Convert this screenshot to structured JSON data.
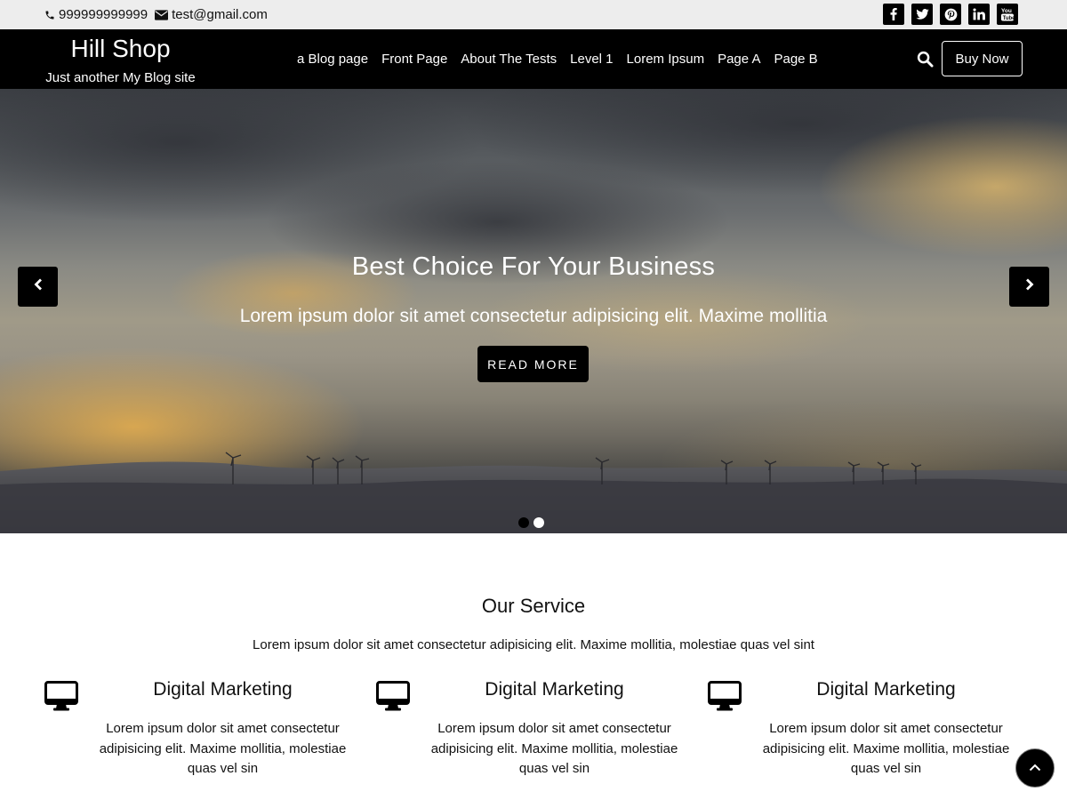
{
  "topbar": {
    "phone": "999999999999",
    "email": "test@gmail.com",
    "social": [
      "facebook-icon",
      "twitter-icon",
      "pinterest-icon",
      "linkedin-icon",
      "youtube-icon"
    ]
  },
  "header": {
    "site_title": "Hill Shop",
    "tagline": "Just another My Blog site",
    "nav": [
      "a Blog page",
      "Front Page",
      "About The Tests",
      "Level 1",
      "Lorem Ipsum",
      "Page A",
      "Page B"
    ],
    "buy_label": "Buy Now"
  },
  "hero": {
    "title": "Best Choice For Your Business",
    "subtitle": "Lorem ipsum dolor sit amet consectetur adipisicing elit. Maxime mollitia",
    "cta": "READ MORE",
    "active_slide": 1,
    "slide_count": 2
  },
  "services": {
    "heading": "Our Service",
    "intro": "Lorem ipsum dolor sit amet consectetur adipisicing elit. Maxime mollitia, molestiae quas vel sint",
    "items": [
      {
        "icon": "desktop-icon",
        "title": "Digital Marketing",
        "text": "Lorem ipsum dolor sit amet consectetur adipisicing elit. Maxime mollitia, molestiae quas vel sin"
      },
      {
        "icon": "desktop-icon",
        "title": "Digital Marketing",
        "text": "Lorem ipsum dolor sit amet consectetur adipisicing elit. Maxime mollitia, molestiae quas vel sin"
      },
      {
        "icon": "desktop-icon",
        "title": "Digital Marketing",
        "text": "Lorem ipsum dolor sit amet consectetur adipisicing elit. Maxime mollitia, molestiae quas vel sin"
      }
    ]
  },
  "colors": {
    "header_bg": "#000000",
    "topbar_bg": "#ededed",
    "accent": "#000000",
    "text": "#111111"
  }
}
